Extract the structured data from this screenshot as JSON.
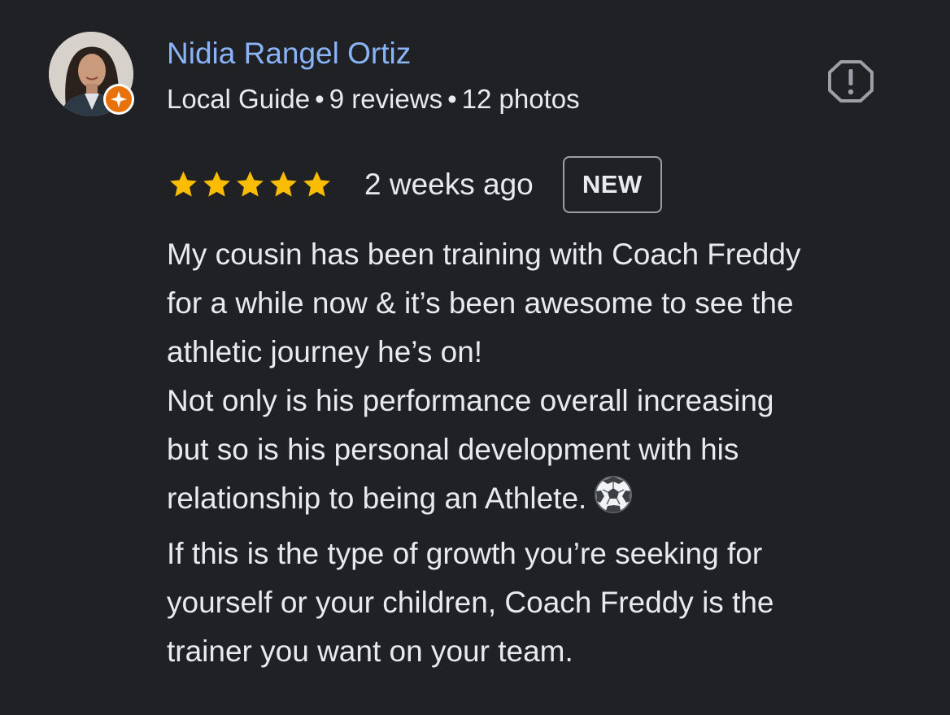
{
  "reviewer": {
    "name": "Nidia Rangel Ortiz",
    "level": "Local Guide",
    "reviews_count": "9 reviews",
    "photos_count": "12 photos",
    "separator": "•"
  },
  "review": {
    "rating": 5,
    "max_rating": 5,
    "time_ago": "2 weeks ago",
    "badge": "NEW",
    "lines": [
      "My cousin has been training with Coach Freddy",
      "for a while now & it’s been awesome to see the",
      "athletic journey he’s on!",
      "Not only is his performance overall increasing",
      "but so is his personal development with his",
      "relationship to being an Athlete.",
      "If this is the type of growth you’re seeking for",
      "yourself or your children, Coach Freddy is the",
      "trainer you want on your team."
    ]
  },
  "icons": {
    "report": "report-flag-icon",
    "star": "star-icon",
    "local_guide": "local-guide-badge-icon",
    "soccer_ball": "soccer-ball-icon"
  },
  "colors": {
    "background": "#202124",
    "name_link": "#8ab4f8",
    "text": "#e8eaed",
    "star": "#fbbc04",
    "guide_badge": "#e8710a",
    "badge_border": "#9aa0a6"
  }
}
